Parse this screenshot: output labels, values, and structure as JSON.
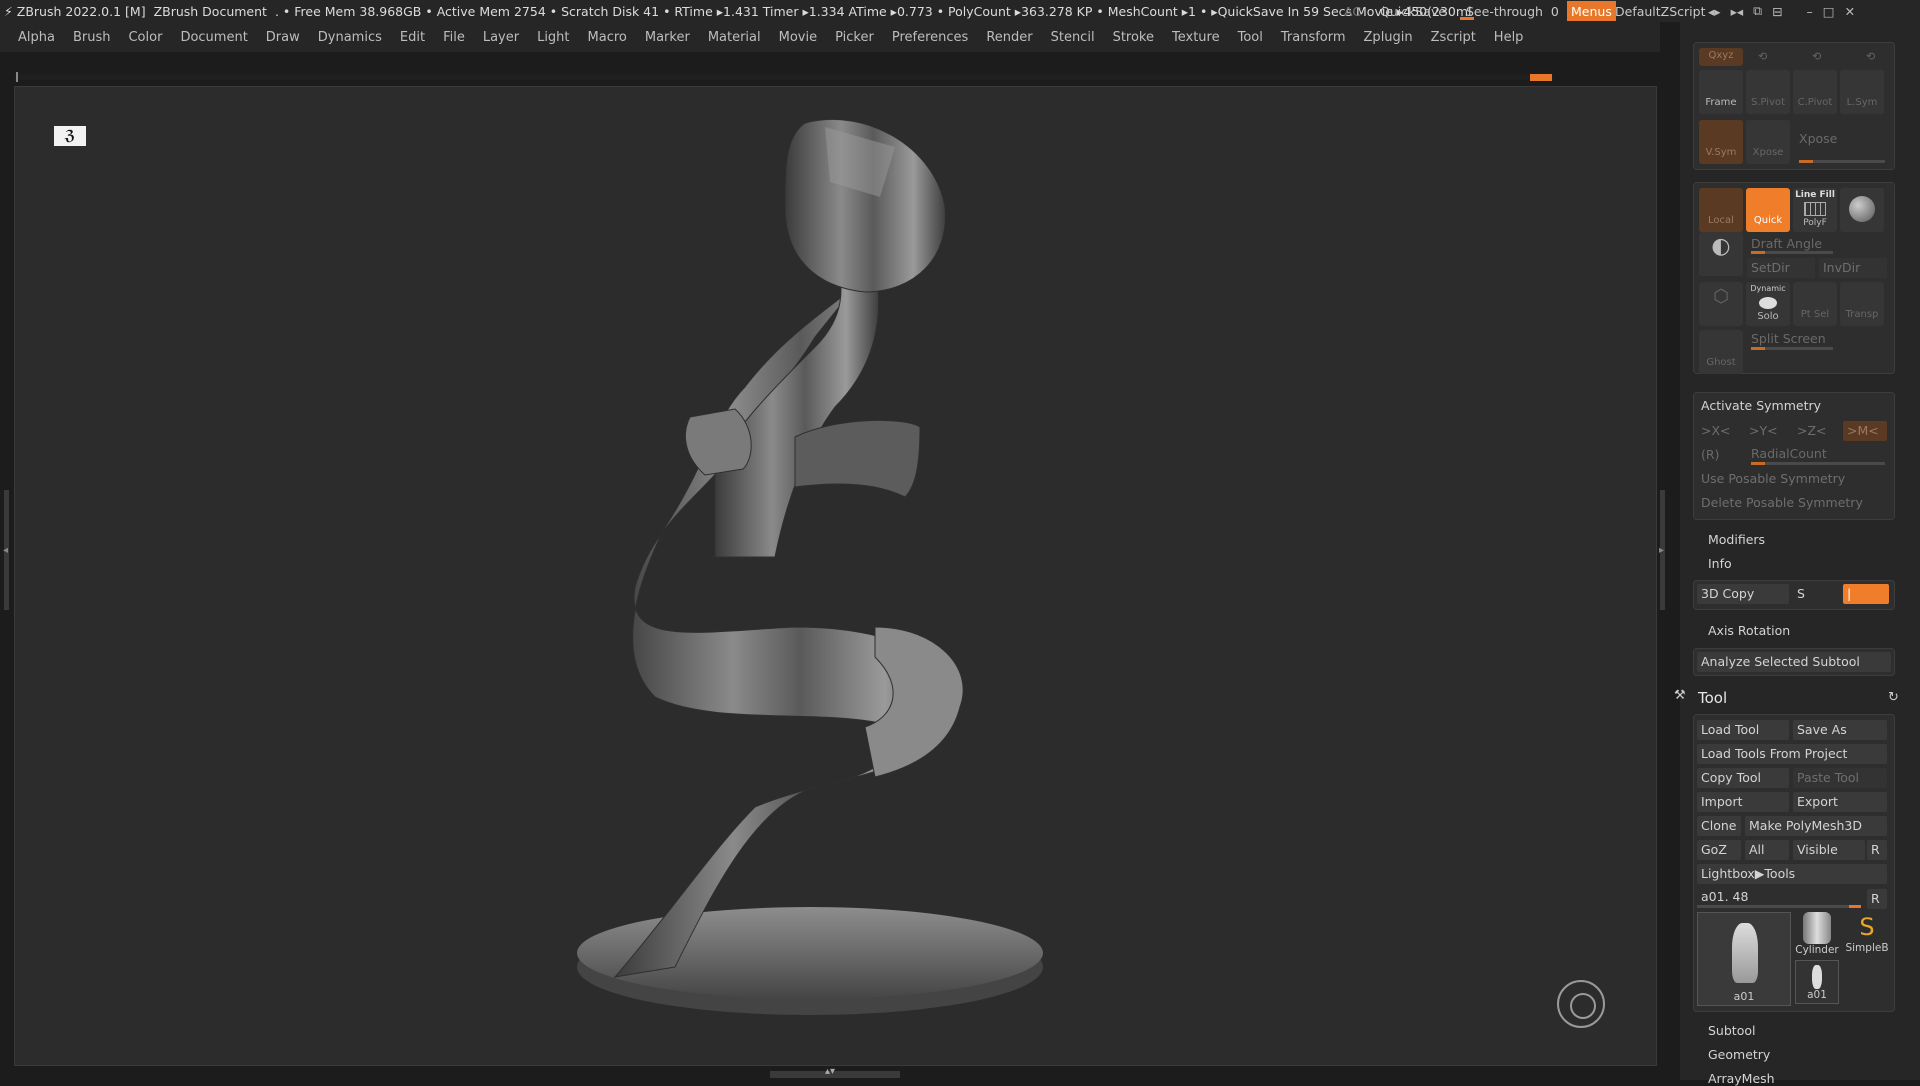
{
  "titlebar": {
    "app_title": "ZBrush 2022.0.1 [M]",
    "doc_title": "ZBrush Document",
    "stats": ". • Free Mem 38.968GB • Active Mem 2754 • Scratch Disk 41 • RTime ▸1.431 Timer ▸1.334 ATime ▸0.773 • PolyCount ▸363.278 KP • MeshCount ▸1 • ▸QuickSave In 59 Secs Movie ▸450(230ml",
    "ac": "AC",
    "quicksave": "QuickSave",
    "see_through_label": "See-through",
    "see_through_value": "0",
    "menus": "Menus",
    "default_zscript": "DefaultZScript"
  },
  "menubar": [
    "Alpha",
    "Brush",
    "Color",
    "Document",
    "Draw",
    "Dynamics",
    "Edit",
    "File",
    "Layer",
    "Light",
    "Macro",
    "Marker",
    "Material",
    "Movie",
    "Picker",
    "Preferences",
    "Render",
    "Stencil",
    "Stroke",
    "Texture",
    "Tool",
    "Transform",
    "Zplugin",
    "Zscript",
    "Help"
  ],
  "viewport": {
    "nav_glyph": "ℨ"
  },
  "view_group": {
    "xyz": "Qxyz",
    "frame": "Frame",
    "spivot": "S.Pivot",
    "cpivot": "C.Pivot",
    "lsym": "L.Sym",
    "vsym": "V.Sym",
    "xpose_btn": "Xpose",
    "xpose_label": "Xpose"
  },
  "draw_group": {
    "local": "Local",
    "quick": "Quick",
    "line_fill": "Line Fill",
    "polyf": "PolyF",
    "draft_angle": "Draft Angle",
    "setdir": "SetDir",
    "invdir": "InvDir",
    "dynamic": "Dynamic",
    "solo": "Solo",
    "ptsel": "Pt Sel",
    "transp": "Transp",
    "ghost": "Ghost",
    "split_screen": "Split Screen"
  },
  "symmetry": {
    "activate": "Activate Symmetry",
    "x": ">X<",
    "y": ">Y<",
    "z": ">Z<",
    "m": ">M<",
    "r": "(R)",
    "radial": "RadialCount",
    "use_posable": "Use Posable Symmetry",
    "delete_posable": "Delete Posable Symmetry"
  },
  "transform_misc": {
    "modifiers": "Modifiers",
    "info": "Info",
    "copy3d": "3D Copy",
    "s": "S",
    "axis_rotation": "Axis Rotation",
    "analyze": "Analyze Selected Subtool"
  },
  "tool_panel": {
    "title": "Tool",
    "load_tool": "Load Tool",
    "save_as": "Save As",
    "load_from_project": "Load Tools From Project",
    "copy_tool": "Copy Tool",
    "paste_tool": "Paste Tool",
    "import": "Import",
    "export": "Export",
    "clone": "Clone",
    "make_polymesh": "Make PolyMesh3D",
    "goz": "GoZ",
    "all": "All",
    "visible": "Visible",
    "r": "R",
    "lightbox": "Lightbox▶Tools",
    "current_tool": "a01. 48",
    "r2": "R",
    "thumbs": [
      "a01",
      "Cylinder",
      "SimpleB",
      "a01"
    ]
  },
  "sections": [
    "Subtool",
    "Geometry",
    "ArrayMesh"
  ]
}
